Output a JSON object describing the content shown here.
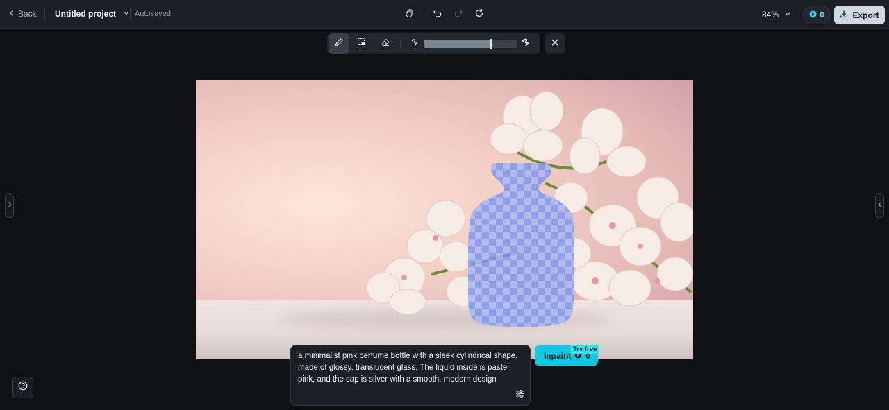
{
  "header": {
    "back_label": "Back",
    "project_title": "Untitled project",
    "save_status": "Autosaved",
    "zoom_level": "84%",
    "credits": "0",
    "export_label": "Export"
  },
  "toolbar": {
    "brush_size": 0.72
  },
  "prompt": {
    "text": "a minimalist pink perfume bottle with a sleek cylindrical shape, made of glossy, translucent glass. The liquid inside is pastel pink, and the cap is silver with a smooth, modern design"
  },
  "inpaint": {
    "label": "Inpaint",
    "cost": "0",
    "badge": "Try free"
  },
  "colors": {
    "accent": "#14c6df",
    "mask": "#7f97ee"
  }
}
